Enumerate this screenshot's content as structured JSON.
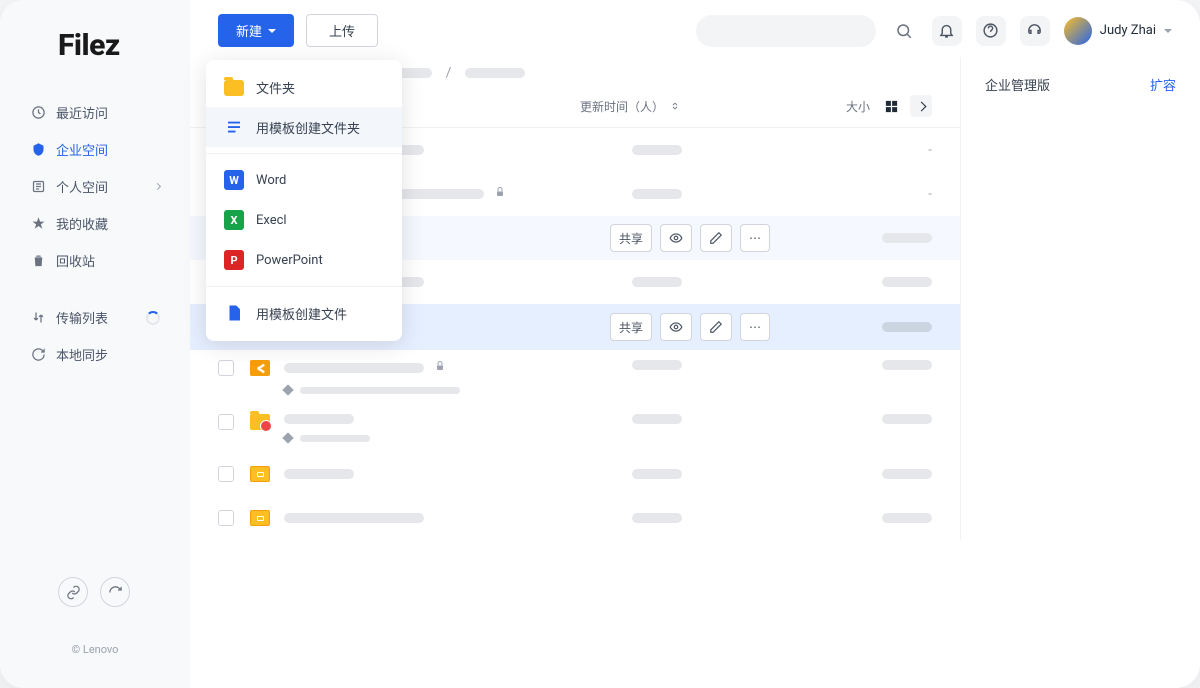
{
  "brand": "Filez",
  "sidebar": {
    "items": [
      {
        "label": "最近访问",
        "icon": "clock"
      },
      {
        "label": "企业空间",
        "icon": "enterprise"
      },
      {
        "label": "个人空间",
        "icon": "person"
      },
      {
        "label": "我的收藏",
        "icon": "star"
      },
      {
        "label": "回收站",
        "icon": "trash"
      }
    ],
    "secondary": [
      {
        "label": "传输列表",
        "icon": "transfer"
      },
      {
        "label": "本地同步",
        "icon": "sync"
      }
    ],
    "copyright": "© Lenovo"
  },
  "topbar": {
    "new_label": "新建",
    "upload_label": "上传",
    "user_name": "Judy Zhai"
  },
  "dropdown": {
    "items": [
      {
        "label": "文件夹",
        "icon": "folder"
      },
      {
        "label": "用模板创建文件夹",
        "icon": "template"
      },
      {
        "sep": true
      },
      {
        "label": "Word",
        "icon": "word"
      },
      {
        "label": "Execl",
        "icon": "excel"
      },
      {
        "label": "PowerPoint",
        "icon": "ppt"
      },
      {
        "sep": true
      },
      {
        "label": "用模板创建文件",
        "icon": "file"
      }
    ]
  },
  "list_header": {
    "time_label": "更新时间（人）",
    "size_label": "大小"
  },
  "actions": {
    "share": "共享"
  },
  "right_panel": {
    "title": "企业管理版",
    "link": "扩容"
  },
  "rows": [
    {
      "type": "folder",
      "size": "-"
    },
    {
      "type": "folder",
      "size": "-",
      "locked": true
    },
    {
      "type": "folder",
      "actions": true
    },
    {
      "type": "folder"
    },
    {
      "type": "share",
      "selected": true,
      "actions": true,
      "editable": true
    },
    {
      "type": "share",
      "locked_after": true,
      "subline": true
    },
    {
      "type": "special",
      "subline": true
    },
    {
      "type": "box"
    },
    {
      "type": "box"
    }
  ]
}
